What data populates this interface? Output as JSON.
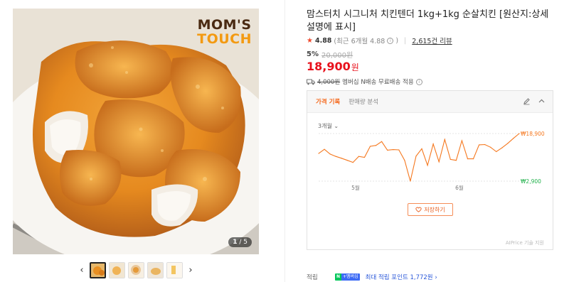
{
  "product": {
    "brand_line1": "MOM'S",
    "brand_line2": "TOUCH",
    "image_counter_current": "1",
    "image_counter_total": "/ 5",
    "thumbnail_count": 5,
    "title": "맘스터치 시그니처 치킨텐더 1kg+1kg 순살치킨 [원산지:상세설명에 표시]"
  },
  "rating": {
    "score": "4.88",
    "recent": "(최근 6개월 4.88",
    "recent_close": ")",
    "reviews": "2,615건 리뷰"
  },
  "pricing": {
    "discount": "5%",
    "original": "20,000원",
    "price": "18,900",
    "currency": "원"
  },
  "shipping": {
    "old_fee": "4,000원",
    "text": "멤버십 N배송 무료배송 적용"
  },
  "price_panel": {
    "tab_active": "가격 기록",
    "tab_other": "판매량 분석",
    "range_label": "3개월",
    "save_label": "저장하기",
    "credit": "AIPrice 기술 지원",
    "accent_color": "#f5781f",
    "min_color": "#22b14c"
  },
  "chart_data": {
    "type": "line",
    "x_tick_labels": [
      "5월",
      "6월"
    ],
    "max_label": "₩18,900",
    "min_label": "₩2,900",
    "values": [
      12.2,
      13.6,
      12.0,
      11.2,
      10.6,
      9.9,
      9.2,
      11.2,
      10.9,
      14.6,
      14.9,
      16.2,
      13.3,
      13.5,
      13.4,
      9.9,
      2.9,
      11.3,
      13.8,
      8.2,
      15.4,
      9.4,
      16.9,
      10.2,
      9.9,
      16.5,
      10.4,
      10.4,
      15.1,
      15.2,
      14.3,
      12.8,
      14.1,
      15.6,
      17.3,
      18.9
    ]
  },
  "points": {
    "label": "적립",
    "badge_n": "N",
    "badge_plus": "+멤버십",
    "text": "최대 적립 포인트 1,772원"
  }
}
